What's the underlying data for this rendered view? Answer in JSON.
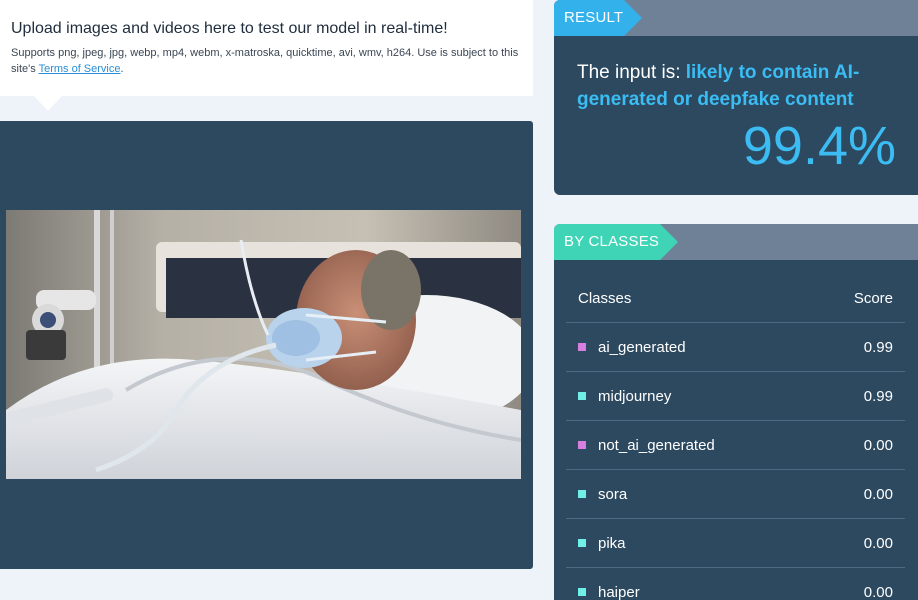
{
  "upload": {
    "title": "Upload images and videos here to test our model in real-time!",
    "subtitle": "Supports png, jpeg, jpg, webp, mp4, webm, x-matroska, quicktime, avi, wmv, h264. Use is subject to this site's",
    "tos_link": "Terms of Service",
    "tos_suffix": "."
  },
  "result": {
    "tag": "RESULT",
    "prefix": "The input is:",
    "verdict": "likely to contain AI-generated or deepfake content",
    "percent": "99.4%"
  },
  "classes": {
    "tag": "BY CLASSES",
    "header_class": "Classes",
    "header_score": "Score",
    "rows": [
      {
        "name": "ai_generated",
        "score": "0.99",
        "color": "#d77fe0"
      },
      {
        "name": "midjourney",
        "score": "0.99",
        "color": "#6ff0e6"
      },
      {
        "name": "not_ai_generated",
        "score": "0.00",
        "color": "#d77fe0"
      },
      {
        "name": "sora",
        "score": "0.00",
        "color": "#6ff0e6"
      },
      {
        "name": "pika",
        "score": "0.00",
        "color": "#6ff0e6"
      },
      {
        "name": "haiper",
        "score": "0.00",
        "color": "#6ff0e6"
      }
    ]
  },
  "colors": {
    "panel": "#2c4960",
    "result_accent": "#32b1ea",
    "classes_accent": "#3fd4b6",
    "header_bar": "#6e8197"
  }
}
